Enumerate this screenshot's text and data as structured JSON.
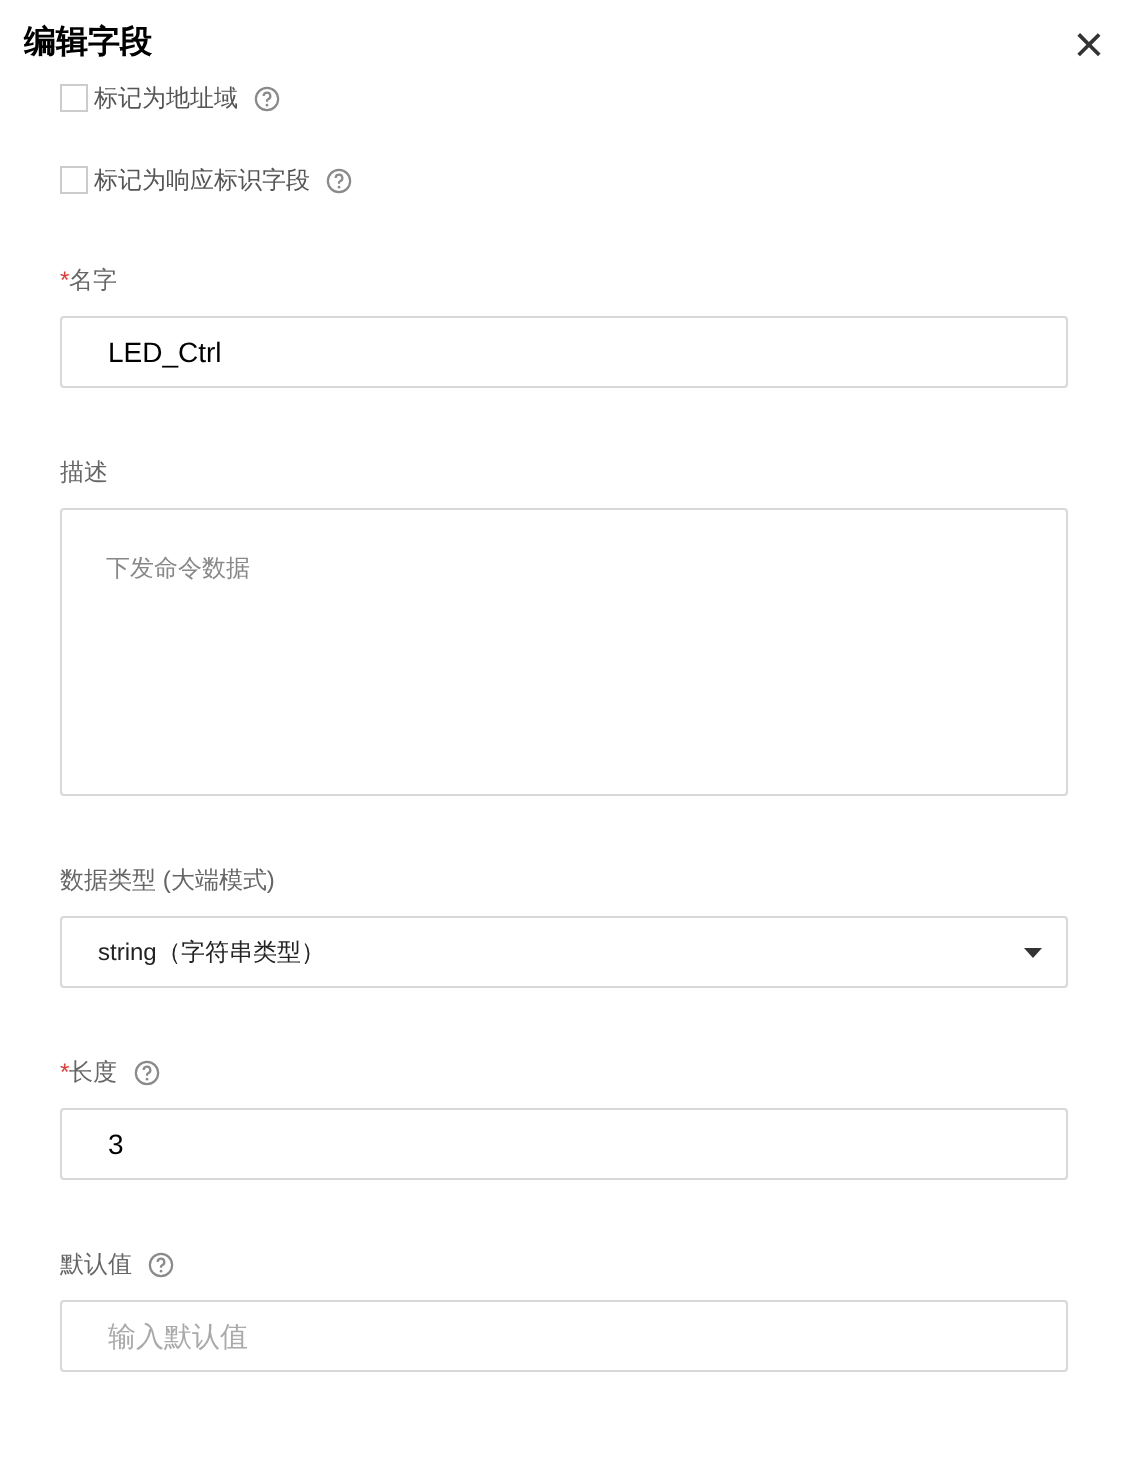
{
  "dialog": {
    "title": "编辑字段",
    "close": "×"
  },
  "checkboxes": [
    {
      "label": "标记为地址域",
      "checked": false,
      "help": true
    },
    {
      "label": "标记为响应标识字段",
      "checked": false,
      "help": true
    }
  ],
  "fields": [
    {
      "kind": "input",
      "label": "名字",
      "required_mark": "*",
      "help": false,
      "value": "LED_Ctrl"
    },
    {
      "kind": "textarea",
      "label": "描述",
      "help": false,
      "placeholder": "下发命令数据"
    },
    {
      "kind": "select",
      "label": "数据类型 (大端模式)",
      "help": false,
      "value": "string（字符串类型）"
    },
    {
      "kind": "input",
      "label": "长度",
      "required_mark": "*",
      "help": true,
      "value": "3"
    },
    {
      "kind": "input",
      "label": "默认值",
      "help": true,
      "placeholder": "输入默认值"
    }
  ]
}
